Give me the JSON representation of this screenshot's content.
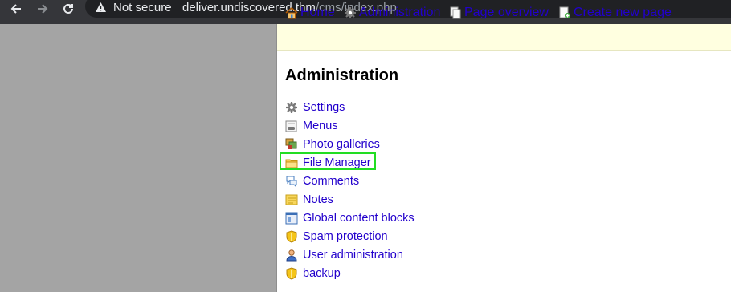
{
  "browser": {
    "security_label": "Not secure",
    "url_host": "deliver.undiscovered.thm",
    "url_path": "/cms/index.php",
    "icons": [
      "back-arrow-icon",
      "forward-arrow-icon",
      "reload-icon",
      "warning-triangle-icon"
    ]
  },
  "topnav": {
    "home": "Home",
    "administration": "Administration",
    "page_overview": "Page overview",
    "create_new_page": "Create new page"
  },
  "main": {
    "title": "Administration",
    "items": [
      {
        "label": "Settings",
        "icon": "gear-icon"
      },
      {
        "label": "Menus",
        "icon": "menu-icon"
      },
      {
        "label": "Photo galleries",
        "icon": "photo-gallery-icon"
      },
      {
        "label": "File Manager",
        "icon": "folder-icon"
      },
      {
        "label": "Comments",
        "icon": "comments-icon"
      },
      {
        "label": "Notes",
        "icon": "notes-icon"
      },
      {
        "label": "Global content blocks",
        "icon": "content-blocks-icon"
      },
      {
        "label": "Spam protection",
        "icon": "shield-icon"
      },
      {
        "label": "User administration",
        "icon": "user-icon"
      },
      {
        "label": "backup",
        "icon": "shield-icon"
      }
    ]
  },
  "colors": {
    "link": "#2200cc",
    "topbar_bg": "#ffffe0",
    "left_pane": "#a4a4a4",
    "highlight": "#22dd22"
  }
}
